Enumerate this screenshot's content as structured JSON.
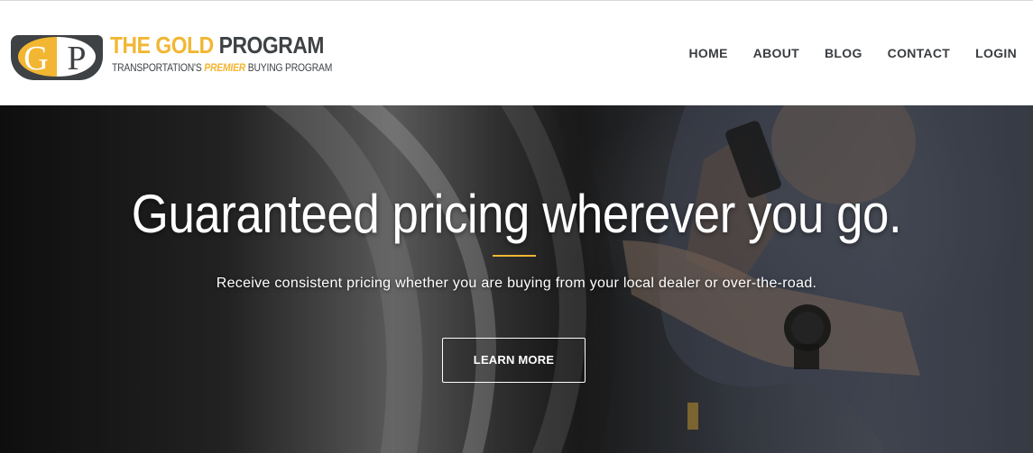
{
  "brand": {
    "badge_letters": [
      "G",
      "P"
    ],
    "title_part1": "THE GOLD",
    "title_part2": "PROGRAM",
    "tagline_prefix": "TRANSPORTATION'S",
    "tagline_highlight": "PREMIER",
    "tagline_suffix": "BUYING PROGRAM",
    "colors": {
      "gold": "#f2b632",
      "dark": "#3f4245"
    }
  },
  "nav": {
    "items": [
      {
        "label": "HOME"
      },
      {
        "label": "ABOUT"
      },
      {
        "label": "BLOG"
      },
      {
        "label": "CONTACT"
      },
      {
        "label": "LOGIN"
      }
    ]
  },
  "hero": {
    "heading": "Guaranteed pricing wherever you go.",
    "subheading": "Receive consistent pricing whether you are buying from your local dealer or over-the-road.",
    "cta_label": "LEARN MORE",
    "accent_color": "#f2b632"
  }
}
